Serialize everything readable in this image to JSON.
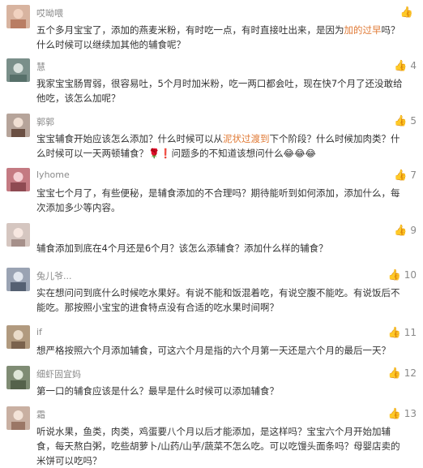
{
  "comments": [
    {
      "nickname": "哎呦喂",
      "likes": "",
      "avatar": "avatar-photo",
      "text_parts": [
        {
          "t": "五个多月宝宝了，添加的燕麦米粉，有时吃一点，有时直接吐出来，是因为"
        },
        {
          "t": "加的过早",
          "hl": true
        },
        {
          "t": "吗？什么时候可以继续加其他的辅食呢？"
        }
      ]
    },
    {
      "nickname": "慧",
      "likes": "4",
      "avatar": "avatar-photo",
      "text_parts": [
        {
          "t": "我家宝宝肠胃弱，很容易吐，5个月时加米粉，吃一两口都会吐，现在快7个月了还没敢给他吃，该怎么加呢？"
        }
      ]
    },
    {
      "nickname": "郭郭",
      "likes": "5",
      "avatar": "avatar-photo",
      "text_parts": [
        {
          "t": "宝宝辅食开始应该怎么添加？什么时候可以从"
        },
        {
          "t": "泥状过渡到",
          "hl": true
        },
        {
          "t": "下个阶段？什么时候加肉类？什么时候可以一天两顿辅食？🌹❗问题多的不知道该想问什么😂😂😂"
        }
      ]
    },
    {
      "nickname": "lyhome",
      "likes": "7",
      "avatar": "avatar-photo",
      "text_parts": [
        {
          "t": "宝宝七个月了，有些便秘，是辅食添加的不合理吗？期待能听到如何添加，添加什么，每次添加多少等内容。"
        }
      ]
    },
    {
      "nickname": "",
      "likes": "9",
      "avatar": "avatar-photo",
      "text_parts": [
        {
          "t": "辅食添加到底在4个月还是6个月？该怎么添辅食？添加什么样的辅食？"
        }
      ]
    },
    {
      "nickname": "兔儿爷...",
      "likes": "10",
      "avatar": "avatar-photo",
      "text_parts": [
        {
          "t": "实在想问问到底什么时候吃水果好。有说不能和饭混着吃，有说空腹不能吃。有说饭后不能吃。那按照小宝宝的进食特点没有合适的吃水果时间啊？"
        }
      ]
    },
    {
      "nickname": "if",
      "likes": "11",
      "avatar": "avatar-photo",
      "text_parts": [
        {
          "t": "想严格按照六个月添加辅食，可这六个月是指的六个月第一天还是六个月的最后一天？"
        }
      ]
    },
    {
      "nickname": "细虾固宜妈",
      "likes": "12",
      "avatar": "avatar-photo",
      "text_parts": [
        {
          "t": "第一口的辅食应该是什么？最早是什么时候可以添加辅食？"
        }
      ]
    },
    {
      "nickname": "霜",
      "likes": "13",
      "avatar": "avatar-photo",
      "text_parts": [
        {
          "t": "听说水果，鱼类，肉类，鸡蛋要八个月以后才能添加，是这样吗？宝宝六个月开始加辅食，每天熬白粥，吃些胡萝卜/山药/山芋/蔬菜不怎么吃。可以吃馒头面条吗？母婴店卖的米饼可以吃吗？"
        }
      ]
    }
  ],
  "colors": {
    "highlight": "#e07a36",
    "nickname": "#8a8a8a",
    "text": "#333333"
  }
}
